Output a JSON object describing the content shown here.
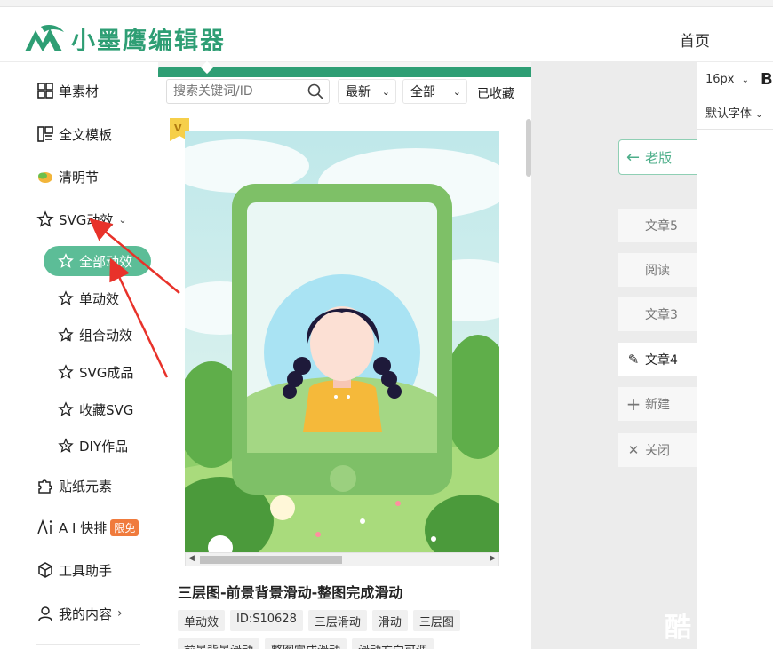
{
  "brand": {
    "name": "小墨鹰编辑器"
  },
  "nav": {
    "home": "首页"
  },
  "sidebar": {
    "items": [
      {
        "label": "单素材",
        "icon": "grid-icon"
      },
      {
        "label": "全文模板",
        "icon": "template-icon"
      },
      {
        "label": "清明节",
        "icon": "leaf-icon"
      },
      {
        "label": "SVG动效",
        "icon": "star-outline-icon",
        "expanded": true
      },
      {
        "label": "贴纸元素",
        "icon": "puzzle-icon"
      },
      {
        "label": "A I 快排",
        "icon": "ai-icon",
        "badge": "限免"
      },
      {
        "label": "工具助手",
        "icon": "cube-icon"
      },
      {
        "label": "我的内容",
        "icon": "user-icon"
      }
    ],
    "sub_items": [
      {
        "label": "全部动效",
        "active": true
      },
      {
        "label": "单动效"
      },
      {
        "label": "组合动效"
      },
      {
        "label": "SVG成品"
      },
      {
        "label": "收藏SVG"
      },
      {
        "label": "DIY作品"
      }
    ]
  },
  "toolbar": {
    "search_placeholder": "搜索关键词/ID",
    "sort_value": "最新",
    "filter_value": "全部",
    "favorites": "已收藏"
  },
  "card": {
    "title": "三层图-前景背景滑动-整图完成滑动",
    "tags": [
      "单动效",
      "ID:S10628",
      "三层滑动",
      "滑动",
      "三层图",
      "前景背景滑动",
      "整图完成滑动",
      "滑动方向可调"
    ]
  },
  "right_panel": {
    "old_version": "老版",
    "buttons": [
      {
        "label": "文章5"
      },
      {
        "label": "阅读"
      },
      {
        "label": "文章3"
      },
      {
        "label": "文章4",
        "active": true,
        "icon": "edit-icon"
      },
      {
        "label": "新建",
        "icon": "plus-icon"
      },
      {
        "label": "关闭",
        "icon": "close-icon"
      }
    ]
  },
  "format_panel": {
    "font_size": "16px",
    "bold": "B",
    "font_family": "默认字体"
  },
  "colors": {
    "brand_green": "#2e9e74",
    "active_pill": "#5cbd97",
    "badge_orange": "#f07b3d",
    "arrow_red": "#e8322a"
  }
}
